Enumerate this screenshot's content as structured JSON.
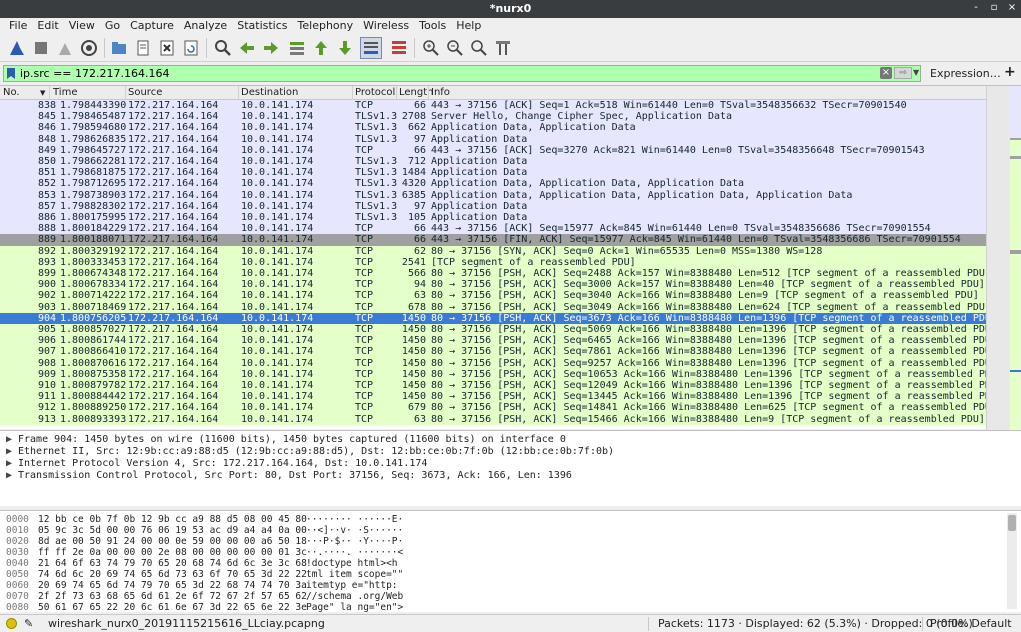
{
  "window": {
    "title": "*nurx0",
    "controls": [
      "-",
      "▫",
      "×"
    ]
  },
  "menu": [
    {
      "label": "File"
    },
    {
      "label": "Edit"
    },
    {
      "label": "View"
    },
    {
      "label": "Go"
    },
    {
      "label": "Capture"
    },
    {
      "label": "Analyze"
    },
    {
      "label": "Statistics"
    },
    {
      "label": "Telephony"
    },
    {
      "label": "Wireless"
    },
    {
      "label": "Tools"
    },
    {
      "label": "Help"
    }
  ],
  "filter": {
    "value": "ip.src == 172.217.164.164",
    "expression_label": "Expression…",
    "plus": "+"
  },
  "columns": {
    "no": "No.",
    "time": "Time",
    "source": "Source",
    "destination": "Destination",
    "protocol": "Protocol",
    "length": "Length",
    "info": "Info"
  },
  "colors": {
    "tcp_row": "#e7e6ff",
    "http_row": "#e4ffc7",
    "fin_row": "#a0a0a0",
    "selected_row": "#3a7bd5",
    "filter_ok": "#afffaf"
  },
  "packets": [
    {
      "no": "838",
      "time": "1.798443390",
      "src": "172.217.164.164",
      "dst": "10.0.141.174",
      "proto": "TCP",
      "len": "66",
      "info": "443 → 37156 [ACK] Seq=1 Ack=518 Win=61440 Len=0 TSval=3548356632 TSecr=70901540",
      "kind": "tcp"
    },
    {
      "no": "845",
      "time": "1.798465487",
      "src": "172.217.164.164",
      "dst": "10.0.141.174",
      "proto": "TLSv1.3",
      "len": "2708",
      "info": "Server Hello, Change Cipher Spec, Application Data",
      "kind": "tcp"
    },
    {
      "no": "846",
      "time": "1.798594680",
      "src": "172.217.164.164",
      "dst": "10.0.141.174",
      "proto": "TLSv1.3",
      "len": "662",
      "info": "Application Data, Application Data",
      "kind": "tcp"
    },
    {
      "no": "848",
      "time": "1.798626835",
      "src": "172.217.164.164",
      "dst": "10.0.141.174",
      "proto": "TLSv1.3",
      "len": "97",
      "info": "Application Data",
      "kind": "tcp"
    },
    {
      "no": "849",
      "time": "1.798645727",
      "src": "172.217.164.164",
      "dst": "10.0.141.174",
      "proto": "TCP",
      "len": "66",
      "info": "443 → 37156 [ACK] Seq=3270 Ack=821 Win=61440 Len=0 TSval=3548356648 TSecr=70901543",
      "kind": "tcp"
    },
    {
      "no": "850",
      "time": "1.798662281",
      "src": "172.217.164.164",
      "dst": "10.0.141.174",
      "proto": "TLSv1.3",
      "len": "712",
      "info": "Application Data",
      "kind": "tcp"
    },
    {
      "no": "851",
      "time": "1.798681875",
      "src": "172.217.164.164",
      "dst": "10.0.141.174",
      "proto": "TLSv1.3",
      "len": "1484",
      "info": "Application Data",
      "kind": "tcp"
    },
    {
      "no": "852",
      "time": "1.798712695",
      "src": "172.217.164.164",
      "dst": "10.0.141.174",
      "proto": "TLSv1.3",
      "len": "4320",
      "info": "Application Data, Application Data, Application Data",
      "kind": "tcp"
    },
    {
      "no": "853",
      "time": "1.798738903",
      "src": "172.217.164.164",
      "dst": "10.0.141.174",
      "proto": "TLSv1.3",
      "len": "6385",
      "info": "Application Data, Application Data, Application Data, Application Data",
      "kind": "tcp"
    },
    {
      "no": "857",
      "time": "1.798828302",
      "src": "172.217.164.164",
      "dst": "10.0.141.174",
      "proto": "TLSv1.3",
      "len": "97",
      "info": "Application Data",
      "kind": "tcp"
    },
    {
      "no": "886",
      "time": "1.800175995",
      "src": "172.217.164.164",
      "dst": "10.0.141.174",
      "proto": "TLSv1.3",
      "len": "105",
      "info": "Application Data",
      "kind": "tcp"
    },
    {
      "no": "888",
      "time": "1.800184229",
      "src": "172.217.164.164",
      "dst": "10.0.141.174",
      "proto": "TCP",
      "len": "66",
      "info": "443 → 37156 [ACK] Seq=15977 Ack=845 Win=61440 Len=0 TSval=3548356686 TSecr=70901554",
      "kind": "tcp"
    },
    {
      "no": "889",
      "time": "1.800188071",
      "src": "172.217.164.164",
      "dst": "10.0.141.174",
      "proto": "TCP",
      "len": "66",
      "info": "443 → 37156 [FIN, ACK] Seq=15977 Ack=845 Win=61440 Len=0 TSval=3548356686 TSecr=70901554",
      "kind": "fin"
    },
    {
      "no": "892",
      "time": "1.800329192",
      "src": "172.217.164.164",
      "dst": "10.0.141.174",
      "proto": "TCP",
      "len": "62",
      "info": "80 → 37156 [SYN, ACK] Seq=0 Ack=1 Win=65535 Len=0 MSS=1380 WS=128",
      "kind": "http"
    },
    {
      "no": "893",
      "time": "1.800333453",
      "src": "172.217.164.164",
      "dst": "10.0.141.174",
      "proto": "TCP",
      "len": "2541",
      "info": "[TCP segment of a reassembled PDU]",
      "kind": "http"
    },
    {
      "no": "899",
      "time": "1.800674348",
      "src": "172.217.164.164",
      "dst": "10.0.141.174",
      "proto": "TCP",
      "len": "566",
      "info": "80 → 37156 [PSH, ACK] Seq=2488 Ack=157 Win=8388480 Len=512 [TCP segment of a reassembled PDU]",
      "kind": "http"
    },
    {
      "no": "900",
      "time": "1.800678334",
      "src": "172.217.164.164",
      "dst": "10.0.141.174",
      "proto": "TCP",
      "len": "94",
      "info": "80 → 37156 [PSH, ACK] Seq=3000 Ack=157 Win=8388480 Len=40 [TCP segment of a reassembled PDU]",
      "kind": "http"
    },
    {
      "no": "902",
      "time": "1.800714222",
      "src": "172.217.164.164",
      "dst": "10.0.141.174",
      "proto": "TCP",
      "len": "63",
      "info": "80 → 37156 [PSH, ACK] Seq=3040 Ack=166 Win=8388480 Len=9 [TCP segment of a reassembled PDU]",
      "kind": "http"
    },
    {
      "no": "903",
      "time": "1.800718469",
      "src": "172.217.164.164",
      "dst": "10.0.141.174",
      "proto": "TCP",
      "len": "678",
      "info": "80 → 37156 [PSH, ACK] Seq=3049 Ack=166 Win=8388480 Len=624 [TCP segment of a reassembled PDU]",
      "kind": "http"
    },
    {
      "no": "904",
      "time": "1.800756205",
      "src": "172.217.164.164",
      "dst": "10.0.141.174",
      "proto": "TCP",
      "len": "1450",
      "info": "80 → 37156 [PSH, ACK] Seq=3673 Ack=166 Win=8388480 Len=1396 [TCP segment of a reassembled PDU]",
      "kind": "selected"
    },
    {
      "no": "905",
      "time": "1.800857027",
      "src": "172.217.164.164",
      "dst": "10.0.141.174",
      "proto": "TCP",
      "len": "1450",
      "info": "80 → 37156 [PSH, ACK] Seq=5069 Ack=166 Win=8388480 Len=1396 [TCP segment of a reassembled PDU]",
      "kind": "http"
    },
    {
      "no": "906",
      "time": "1.800861744",
      "src": "172.217.164.164",
      "dst": "10.0.141.174",
      "proto": "TCP",
      "len": "1450",
      "info": "80 → 37156 [PSH, ACK] Seq=6465 Ack=166 Win=8388480 Len=1396 [TCP segment of a reassembled PDU]",
      "kind": "http"
    },
    {
      "no": "907",
      "time": "1.800866410",
      "src": "172.217.164.164",
      "dst": "10.0.141.174",
      "proto": "TCP",
      "len": "1450",
      "info": "80 → 37156 [PSH, ACK] Seq=7861 Ack=166 Win=8388480 Len=1396 [TCP segment of a reassembled PDU]",
      "kind": "http"
    },
    {
      "no": "908",
      "time": "1.800870616",
      "src": "172.217.164.164",
      "dst": "10.0.141.174",
      "proto": "TCP",
      "len": "1450",
      "info": "80 → 37156 [PSH, ACK] Seq=9257 Ack=166 Win=8388480 Len=1396 [TCP segment of a reassembled PDU]",
      "kind": "http"
    },
    {
      "no": "909",
      "time": "1.800875358",
      "src": "172.217.164.164",
      "dst": "10.0.141.174",
      "proto": "TCP",
      "len": "1450",
      "info": "80 → 37156 [PSH, ACK] Seq=10653 Ack=166 Win=8388480 Len=1396 [TCP segment of a reassembled PDU]",
      "kind": "http"
    },
    {
      "no": "910",
      "time": "1.800879782",
      "src": "172.217.164.164",
      "dst": "10.0.141.174",
      "proto": "TCP",
      "len": "1450",
      "info": "80 → 37156 [PSH, ACK] Seq=12049 Ack=166 Win=8388480 Len=1396 [TCP segment of a reassembled PDU]",
      "kind": "http"
    },
    {
      "no": "911",
      "time": "1.800884442",
      "src": "172.217.164.164",
      "dst": "10.0.141.174",
      "proto": "TCP",
      "len": "1450",
      "info": "80 → 37156 [PSH, ACK] Seq=13445 Ack=166 Win=8388480 Len=1396 [TCP segment of a reassembled PDU]",
      "kind": "http"
    },
    {
      "no": "912",
      "time": "1.800889250",
      "src": "172.217.164.164",
      "dst": "10.0.141.174",
      "proto": "TCP",
      "len": "679",
      "info": "80 → 37156 [PSH, ACK] Seq=14841 Ack=166 Win=8388480 Len=625 [TCP segment of a reassembled PDU]",
      "kind": "http"
    },
    {
      "no": "913",
      "time": "1.800893393",
      "src": "172.217.164.164",
      "dst": "10.0.141.174",
      "proto": "TCP",
      "len": "63",
      "info": "80 → 37156 [PSH, ACK] Seq=15466 Ack=166 Win=8388480 Len=9 [TCP segment of a reassembled PDU]",
      "kind": "http"
    }
  ],
  "details": [
    "Frame 904: 1450 bytes on wire (11600 bits), 1450 bytes captured (11600 bits) on interface 0",
    "Ethernet II, Src: 12:9b:cc:a9:88:d5 (12:9b:cc:a9:88:d5), Dst: 12:bb:ce:0b:7f:0b (12:bb:ce:0b:7f:0b)",
    "Internet Protocol Version 4, Src: 172.217.164.164, Dst: 10.0.141.174",
    "Transmission Control Protocol, Src Port: 80, Dst Port: 37156, Seq: 3673, Ack: 166, Len: 1396"
  ],
  "bytes": [
    {
      "offset": "0000",
      "hex": "12 bb ce 0b 7f 0b 12 9b  cc a9 88 d5 08 00 45 80",
      "ascii": "········ ······E·"
    },
    {
      "offset": "0010",
      "hex": "05 9c 3c 5d 00 00 76 06  19 53 ac d9 a4 a4 0a 00",
      "ascii": "··<]··v· ·S······"
    },
    {
      "offset": "0020",
      "hex": "8d ae 00 50 91 24 00 00  0e 59 00 00 00 a6 50 18",
      "ascii": "···P·$·· ·Y····P·"
    },
    {
      "offset": "0030",
      "hex": "ff ff 2e 0a 00 00 00 2e  08 00 00 00 00 00 01 3c",
      "ascii": "··.····. ·······<"
    },
    {
      "offset": "0040",
      "hex": "21 64 6f 63 74 79 70 65  20 68 74 6d 6c 3e 3c 68",
      "ascii": "!doctype  html><h"
    },
    {
      "offset": "0050",
      "hex": "74 6d 6c 20 69 74 65 6d  73 63 6f 70 65 3d 22 22",
      "ascii": "tml item scope=\"\""
    },
    {
      "offset": "0060",
      "hex": "20 69 74 65 6d 74 79 70  65 3d 22 68 74 74 70 3a",
      "ascii": " itemtyp e=\"http:"
    },
    {
      "offset": "0070",
      "hex": "2f 2f 73 63 68 65 6d 61  2e 6f 72 67 2f 57 65 62",
      "ascii": "//schema .org/Web"
    },
    {
      "offset": "0080",
      "hex": "50 61 67 65 22 20 6c 61  6e 67 3d 22 65 6e 22 3e",
      "ascii": "Page\" la ng=\"en\">"
    }
  ],
  "status": {
    "file": "wireshark_nurx0_20191115215616_LLciay.pcapng",
    "packets": "Packets: 1173 · Displayed: 62 (5.3%) · Dropped: 0 (0.0%)",
    "profile": "Profile: Default"
  }
}
